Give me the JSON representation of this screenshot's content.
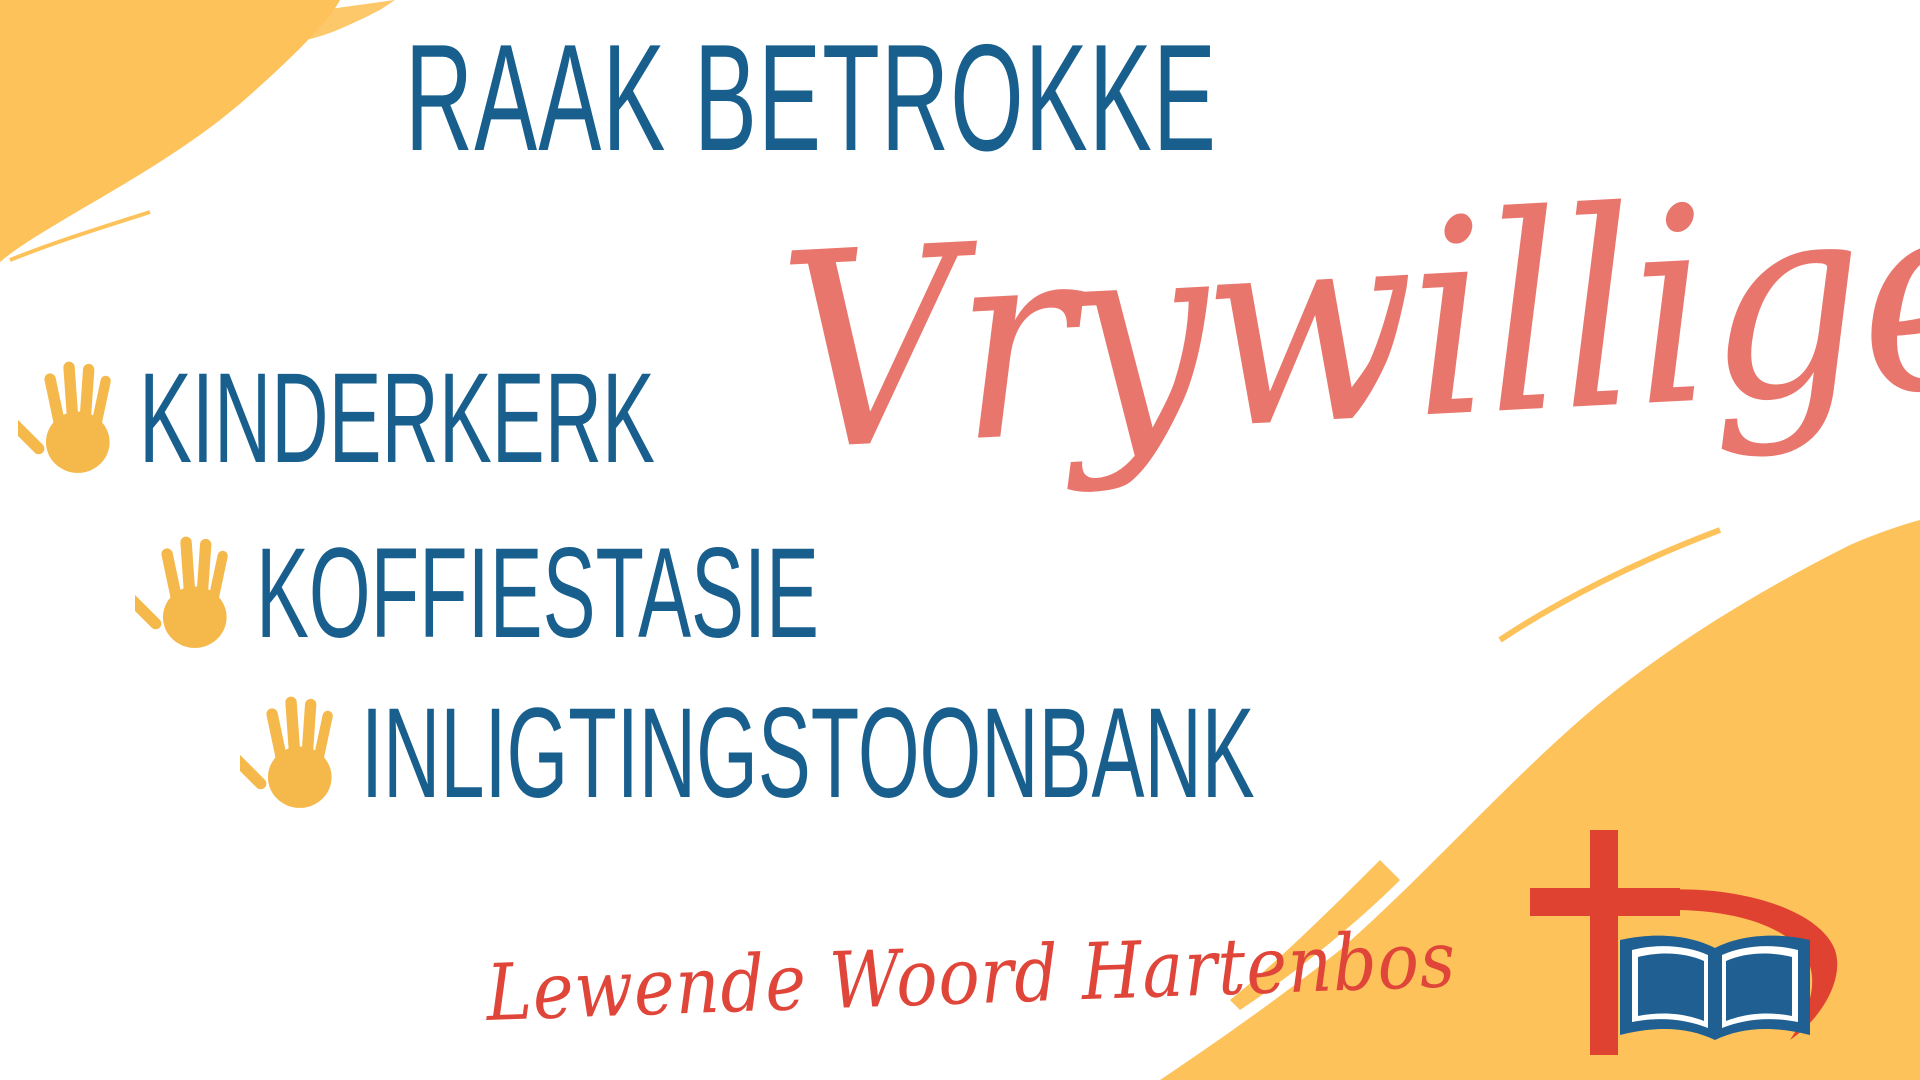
{
  "headline": "RAAK BETROKKE",
  "script_title": "Vrywilligers",
  "items": [
    {
      "label": "KINDERKERK",
      "icon": "handprint-icon"
    },
    {
      "label": "KOFFIESTASIE",
      "icon": "handprint-icon"
    },
    {
      "label": "INLIGTINGSTOONBANK",
      "icon": "handprint-icon"
    }
  ],
  "footer": "Lewende Woord Hartenbos",
  "colors": {
    "accent_yellow": "#fdc25a",
    "headline_blue": "#185f8e",
    "script_coral": "#e8766d",
    "footer_red": "#e0453a",
    "logo_red": "#e04232",
    "logo_blue": "#1f5f91"
  },
  "logo": {
    "icon": "church-cross-bible-logo"
  }
}
